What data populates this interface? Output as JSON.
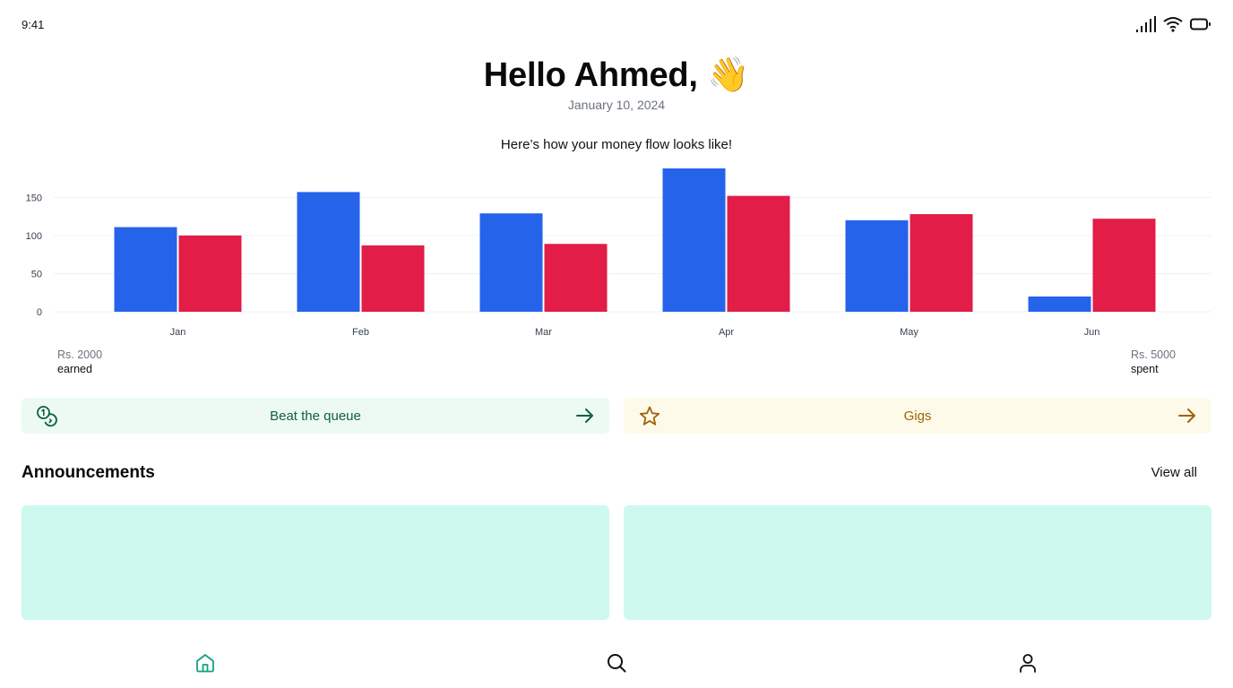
{
  "status_bar": {
    "time": "9:41"
  },
  "header": {
    "greeting": "Hello Ahmed, 👋",
    "date": "January 10, 2024",
    "subtitle": "Here’s how your money flow looks like!"
  },
  "chart_data": {
    "type": "bar",
    "categories": [
      "Jan",
      "Feb",
      "Mar",
      "Apr",
      "May",
      "Jun"
    ],
    "series": [
      {
        "color": "#2563eb",
        "values": [
          111,
          157,
          129,
          188,
          120,
          20
        ]
      },
      {
        "color": "#e11d48",
        "values": [
          100,
          87,
          89,
          152,
          128,
          122
        ]
      }
    ],
    "yticks": [
      0,
      50,
      100,
      150
    ],
    "ylim": [
      0,
      188
    ],
    "grid": true
  },
  "totals": {
    "earned_amount": "Rs. 2000",
    "earned_label": "earned",
    "spent_amount": "Rs. 5000",
    "spent_label": "spent"
  },
  "actions": {
    "queue_label": "Beat the queue",
    "gigs_label": "Gigs"
  },
  "announcements": {
    "title": "Announcements",
    "view_all": "View all"
  },
  "colors": {
    "earned": "#2563eb",
    "spent": "#e11d48",
    "queue_text": "#115e45",
    "gigs_text": "#a16207",
    "announcement_card": "#cdf9ee",
    "nav_active": "#10a37f"
  },
  "icons": {
    "queue": "coins-icon",
    "gigs": "star-icon",
    "arrow": "arrow-right-icon",
    "nav": [
      "home-icon",
      "search-icon",
      "user-icon"
    ]
  }
}
